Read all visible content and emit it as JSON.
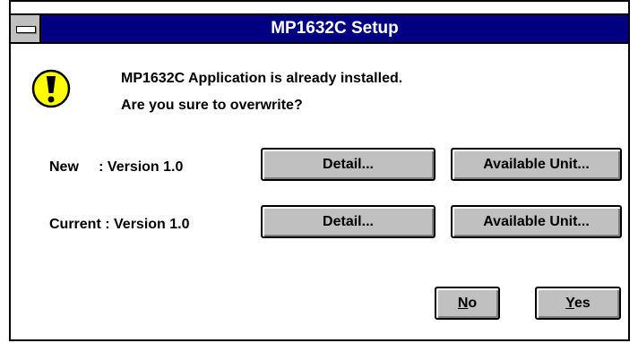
{
  "window": {
    "title": "MP1632C Setup"
  },
  "message": {
    "line1": "MP1632C Application is already installed.",
    "line2": "Are you sure to overwrite?",
    "icon": "exclamation-icon"
  },
  "versions": [
    {
      "label": "New     : Version 1.0",
      "detail_label": "Detail...",
      "available_label": "Available Unit..."
    },
    {
      "label": "Current : Version 1.0",
      "detail_label": "Detail...",
      "available_label": "Available Unit..."
    }
  ],
  "actions": {
    "no": {
      "mnemonic": "N",
      "rest": "o"
    },
    "yes": {
      "mnemonic": "Y",
      "rest": "es"
    }
  },
  "colors": {
    "titlebar": "#000080",
    "button_face": "#c0c0c0",
    "icon_fill": "#ffff00"
  }
}
